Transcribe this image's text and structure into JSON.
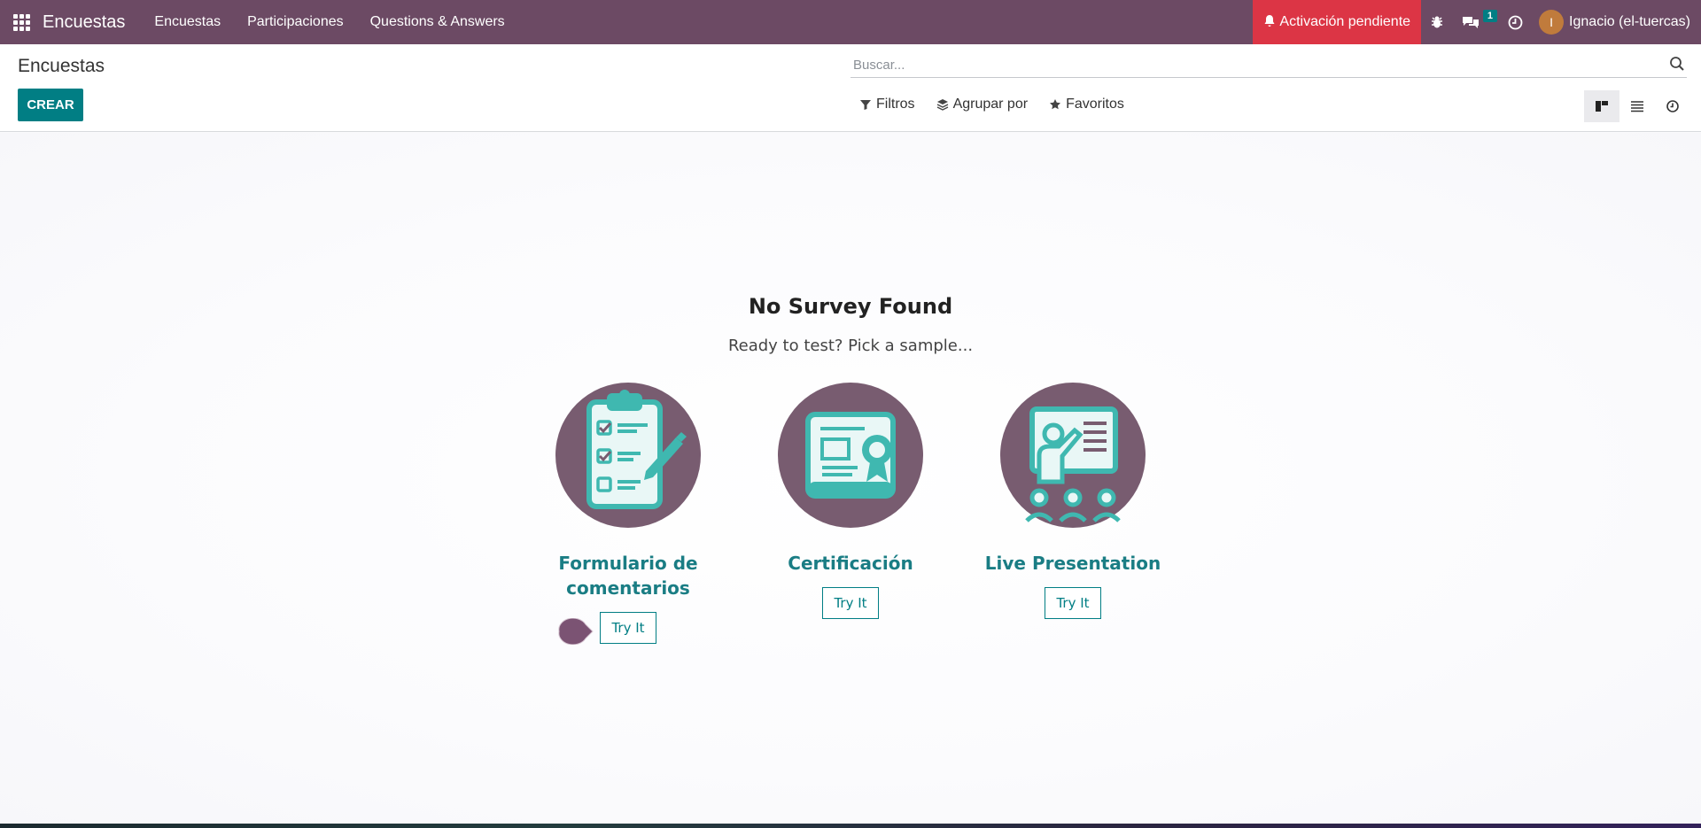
{
  "navbar": {
    "app_title": "Encuestas",
    "menu": [
      "Encuestas",
      "Participaciones",
      "Questions & Answers"
    ],
    "activation_label": "Activación pendiente",
    "messages_badge": "1",
    "user_initial": "I",
    "user_name": "Ignacio (el-tuercas)"
  },
  "control_panel": {
    "breadcrumb": "Encuestas",
    "create_label": "CREAR",
    "search_placeholder": "Buscar...",
    "filters_label": "Filtros",
    "group_by_label": "Agrupar por",
    "favorites_label": "Favoritos"
  },
  "helper": {
    "title": "No Survey Found",
    "subtitle": "Ready to test? Pick a sample...",
    "samples": [
      {
        "title": "Formulario de comentarios",
        "button": "Try It",
        "icon": "clipboard-checklist-icon"
      },
      {
        "title": "Certificación",
        "button": "Try It",
        "icon": "certificate-scroll-icon"
      },
      {
        "title": "Live Presentation",
        "button": "Try It",
        "icon": "presenter-audience-icon"
      }
    ]
  },
  "colors": {
    "navbar": "#6c4a64",
    "accent": "#017e84",
    "activation": "#dc3545",
    "circle": "#785c70",
    "illustration": "#3fb8b0"
  }
}
